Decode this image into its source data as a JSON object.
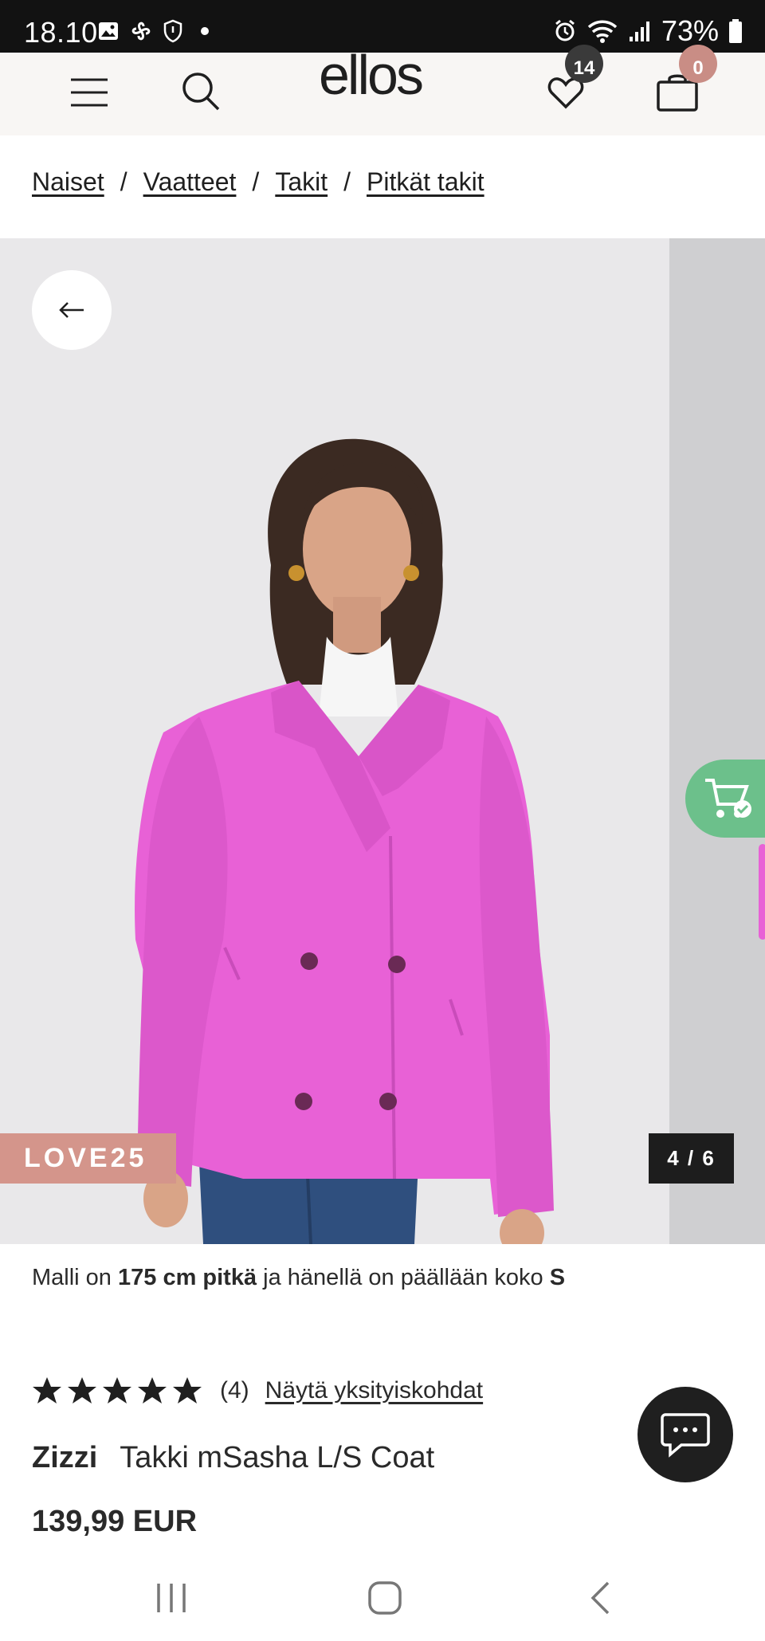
{
  "status_bar": {
    "time": "18.10",
    "battery": "73%"
  },
  "header": {
    "logo": "ellos",
    "wishlist_count": "14",
    "cart_count": "0"
  },
  "breadcrumb": [
    "Naiset",
    "Vaatteet",
    "Takit",
    "Pitkät takit"
  ],
  "gallery": {
    "promo_label": "LOVE25",
    "counter": "4 / 6"
  },
  "model_info": {
    "prefix": "Malli on",
    "height": "175 cm pitkä",
    "middle": "ja hänellä on päällään koko",
    "size": "S"
  },
  "product": {
    "rating": 5,
    "review_count": "(4)",
    "reviews_link": "Näytä yksityiskohdat",
    "brand": "Zizzi",
    "name": "Takki mSasha L/S Coat",
    "price": "139,99 EUR"
  },
  "colors": {
    "coat": "#e861d6",
    "promo": "#d4958b",
    "cart_fab": "#6cc08b"
  }
}
